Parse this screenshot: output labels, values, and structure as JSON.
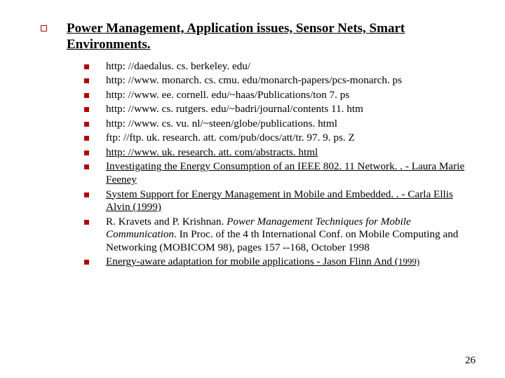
{
  "heading": "Power Management, Application issues, Sensor Nets, Smart Environments.",
  "items": [
    {
      "plain": " http: //daedalus. cs. berkeley. edu/"
    },
    {
      "plain": " http: //www. monarch. cs. cmu. edu/monarch-papers/pcs-monarch. ps"
    },
    {
      "plain": "http: //www. ee. cornell. edu/~haas/Publications/ton 7. ps"
    },
    {
      "plain": "http: //www. cs. rutgers. edu/~badri/journal/contents 11. htm"
    },
    {
      "plain": "http: //www. cs. vu. nl/~steen/globe/publications. html"
    },
    {
      "plain": "ftp: //ftp. uk. research. att. com/pub/docs/att/tr. 97. 9. ps. Z"
    },
    {
      "underline": " http: //www. uk. research. att. com/abstracts. html"
    },
    {
      "underline": "Investigating the Energy Consumption of an IEEE 802. 11 Network. . - Laura Marie Feeney"
    },
    {
      "underline": "System Support for Energy Management in Mobile and Embedded. . - Carla Ellis Alvin (1999)"
    },
    {
      "plain_before": "R. Kravets and P. Krishnan. ",
      "italic": "Power Management Techniques for Mobile Communication",
      "plain_after": ". In Proc. of the 4 th International Conf. on Mobile Computing and Networking (MOBICOM 98), pages 157 --168, October 1998"
    },
    {
      "underline_before": "Energy-aware adaptation for mobile applications - Jason Flinn And (",
      "underline_small": "1999)",
      "underline_after": ""
    }
  ],
  "page_number": "26"
}
